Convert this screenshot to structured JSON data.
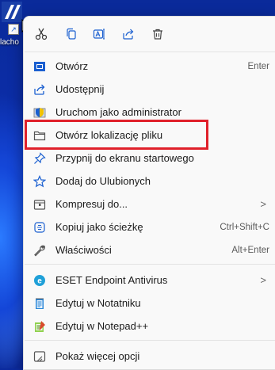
{
  "desktop": {
    "icon_label": "lacho"
  },
  "toolbar": {
    "cut": "cut-icon",
    "copy": "copy-icon",
    "rename": "rename-icon",
    "share": "share-icon",
    "delete": "delete-icon"
  },
  "menu": {
    "items": [
      {
        "label": "Otwórz",
        "shortcut": "Enter",
        "icon": "open-app-icon"
      },
      {
        "label": "Udostępnij",
        "icon": "share-icon"
      },
      {
        "label": "Uruchom jako administrator",
        "icon": "admin-shield-icon"
      },
      {
        "label": "Otwórz lokalizację pliku",
        "icon": "folder-icon"
      },
      {
        "label": "Przypnij do ekranu startowego",
        "icon": "pin-icon"
      },
      {
        "label": "Dodaj do Ulubionych",
        "icon": "star-icon"
      },
      {
        "label": "Kompresuj do...",
        "icon": "zip-icon",
        "submenu": true
      },
      {
        "label": "Kopiuj jako ścieżkę",
        "shortcut": "Ctrl+Shift+C",
        "icon": "copy-path-icon"
      },
      {
        "label": "Właściwości",
        "shortcut": "Alt+Enter",
        "icon": "wrench-icon"
      },
      {
        "label": "ESET Endpoint Antivirus",
        "icon": "eset-icon",
        "submenu": true
      },
      {
        "label": "Edytuj w Notatniku",
        "icon": "notepad-icon"
      },
      {
        "label": "Edytuj w Notepad++",
        "icon": "notepadpp-icon"
      },
      {
        "label": "Pokaż więcej opcji",
        "icon": "more-options-icon"
      }
    ],
    "chevron": ">"
  },
  "colors": {
    "highlight": "#e0202a",
    "accent": "#1a5fd0"
  }
}
